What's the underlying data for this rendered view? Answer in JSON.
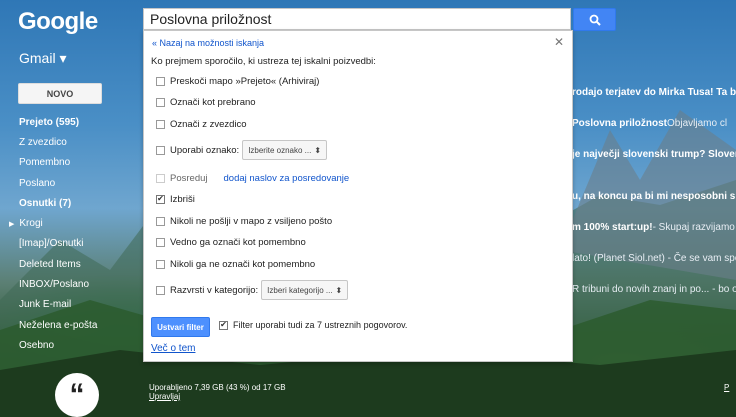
{
  "header": {
    "logo": "Google",
    "search_value": "Poslovna priložnost"
  },
  "sidebar": {
    "app_label": "Gmail ▾",
    "compose_label": "NOVO",
    "items": [
      {
        "label": "Prejeto (595)",
        "bold": true
      },
      {
        "label": "Z zvezdico",
        "bold": false
      },
      {
        "label": "Pomembno",
        "bold": false
      },
      {
        "label": "Poslano",
        "bold": false
      },
      {
        "label": "Osnutki (7)",
        "bold": true
      },
      {
        "label": "Krogi",
        "bold": false
      },
      {
        "label": "[Imap]/Osnutki",
        "bold": false
      },
      {
        "label": "Deleted Items",
        "bold": false
      },
      {
        "label": "INBOX/Poslano",
        "bold": false
      },
      {
        "label": "Junk E-mail",
        "bold": false
      },
      {
        "label": "Neželena e-pošta",
        "bold": false
      },
      {
        "label": "Osebno",
        "bold": false
      }
    ]
  },
  "filter_panel": {
    "back_link": "« Nazaj na možnosti iskanja",
    "intro": "Ko prejmem sporočilo, ki ustreza tej iskalni poizvedbi:",
    "options": {
      "skip_inbox": "Preskoči mapo »Prejeto« (Arhiviraj)",
      "mark_read": "Označi kot prebrano",
      "star": "Označi z zvezdico",
      "apply_label": "Uporabi oznako:",
      "apply_label_select": "Izberite oznako ...",
      "forward": "Posreduj",
      "forward_link": "dodaj naslov za posredovanje",
      "delete": "Izbriši",
      "never_spam": "Nikoli ne pošlji v mapo z vsiljeno pošto",
      "always_important": "Vedno ga označi kot pomembno",
      "never_important": "Nikoli ga ne označi kot pomembno",
      "categorize": "Razvrsti v kategorijo:",
      "categorize_select": "Izberi kategorijo ..."
    },
    "create_button": "Ustvari filter",
    "also_apply": "Filter uporabi tudi za 7 ustreznih pogovorov.",
    "learn_more": "Več o tem"
  },
  "mail_list": [
    {
      "subject": "rodajo terjatev do Mirka Tusa! Ta bo d",
      "snippet": ""
    },
    {
      "subject": "Poslovna priložnost",
      "snippet": " Objavljamo cl"
    },
    {
      "subject": "je največji slovenski trump? Slovens",
      "snippet": ""
    },
    {
      "subject": "",
      "snippet": ""
    },
    {
      "subject": "u, na koncu pa bi mi nesposobni sloo",
      "snippet": ""
    },
    {
      "subject": "m 100% start:up!",
      "snippet": " - Skupaj razvijamo din"
    },
    {
      "subject": "",
      "snippet": "lato! (Planet Siol.net) - Če se vam spor"
    },
    {
      "subject": "",
      "snippet": "R tribuni do novih znanj in po... - bo odl"
    }
  ],
  "footer": {
    "storage": "Uporabljeno 7,39 GB (43 %) od 17 GB",
    "manage": "Upravljaj",
    "right_link": "P"
  },
  "colors": {
    "accent_blue": "#4285f4",
    "link_blue": "#1155cc"
  }
}
